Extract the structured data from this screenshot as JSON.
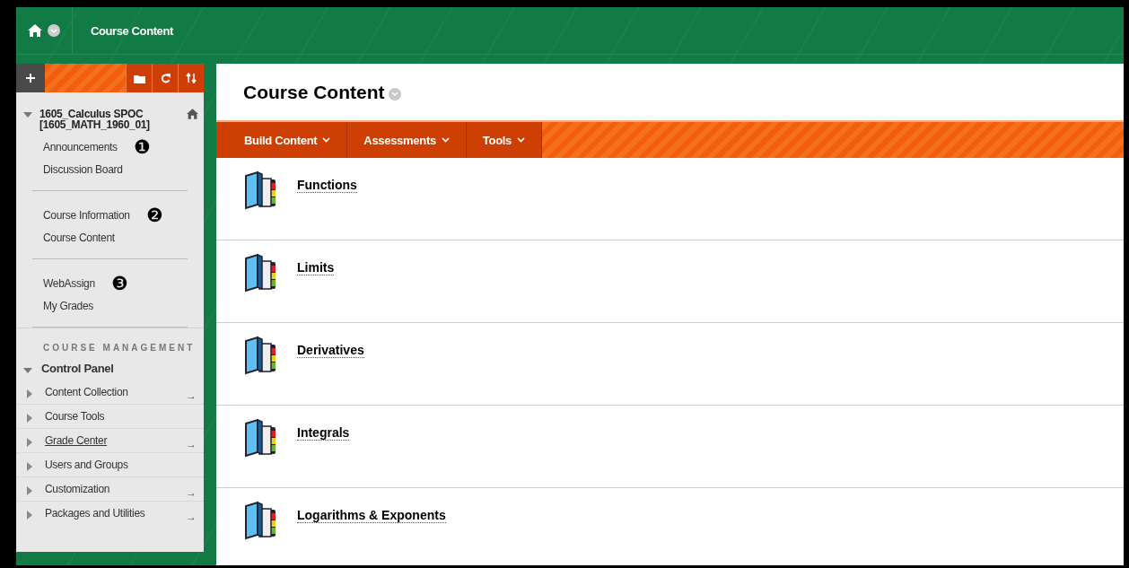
{
  "breadcrumb": {
    "title": "Course Content"
  },
  "sidebar": {
    "course": {
      "name": "1605_Calculus SPOC",
      "code": "[1605_MATH_1960_01]",
      "expanded": true
    },
    "groups": [
      {
        "items": [
          {
            "label": "Announcements",
            "marker": "❶"
          },
          {
            "label": "Discussion Board"
          }
        ]
      },
      {
        "items": [
          {
            "label": "Course Information",
            "marker": "❷"
          },
          {
            "label": "Course Content"
          }
        ]
      },
      {
        "items": [
          {
            "label": "WebAssign",
            "marker": "❸"
          },
          {
            "label": "My Grades"
          }
        ]
      }
    ],
    "management": {
      "heading": "COURSE MANAGEMENT",
      "panel": {
        "label": "Control Panel",
        "expanded": true
      },
      "items": [
        {
          "label": "Content Collection",
          "expanded": false,
          "hovered": false,
          "arrow": "→"
        },
        {
          "label": "Course Tools",
          "expanded": false,
          "hovered": false
        },
        {
          "label": "Grade Center",
          "expanded": false,
          "hovered": true,
          "arrow": "→"
        },
        {
          "label": "Users and Groups",
          "expanded": false,
          "hovered": false
        },
        {
          "label": "Customization",
          "expanded": false,
          "hovered": false,
          "arrow": "→"
        },
        {
          "label": "Packages and Utilities",
          "expanded": false,
          "hovered": false,
          "arrow": "→"
        }
      ]
    }
  },
  "page_title": "Course Content",
  "action_bar": [
    "Build Content",
    "Assessments",
    "Tools"
  ],
  "content_items": [
    "Functions",
    "Limits",
    "Derivatives",
    "Integrals",
    "Logarithms & Exponents"
  ]
}
